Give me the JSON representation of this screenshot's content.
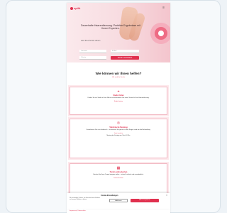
{
  "hero": {
    "logo": "epilō",
    "title": "Dauerhafte Haarentfernung. Perfekte Ergebnisse mit Ihrem Experten.",
    "subtitle": "Jetzt Ihren Termin sichern",
    "input_name_placeholder": "Vorname",
    "input_email_placeholder": "E-Mail",
    "input_phone_placeholder": "Telefon",
    "cta_label": "Termin vereinbaren"
  },
  "section": {
    "title": "Wie können wir Ihnen helfen?",
    "subtitle": "Wir sind für Sie da"
  },
  "cards": [
    {
      "icon": "map-pin-icon",
      "title": "Studio finden",
      "desc": "Finden Sie ein Studio in Ihrer Nähe und vereinbaren Sie einen Termin für Ihre Haarentfernung.",
      "link": "Studio finden"
    },
    {
      "icon": "phone-icon",
      "title": "Telefonische Beratung",
      "desc": "Kontaktieren Sie uns telefonisch – wir beraten Sie gerne zu allen Fragen rund um die Behandlung.",
      "link": "Jetzt anrufen",
      "extra": "Montag bis Freitag von 9 bis 18 Uhr"
    },
    {
      "icon": "calendar-icon",
      "title": "Termin online buchen",
      "desc": "Buchen Sie Ihren Termin bequem online – schnell, einfach und unverbindlich.",
      "link": "Termin buchen"
    }
  ],
  "cookie": {
    "title": "Cookie-Einstellungen",
    "desc": "Wir verwenden Cookies, um Ihnen das beste Erlebnis auf unserer Website zu bieten.",
    "decline": "Ablehnen",
    "accept": "Alle akzeptieren"
  },
  "footer_link": "Impressum | Datenschutz",
  "colors": {
    "accent": "#e0304e",
    "hero_bg": "#f7dbe0",
    "page_bg": "#eef3f7"
  }
}
